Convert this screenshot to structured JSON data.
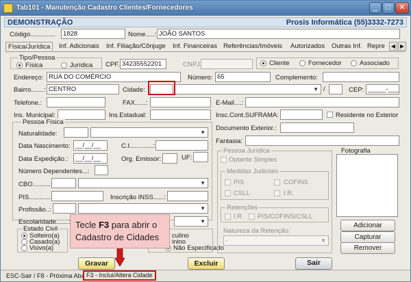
{
  "window": {
    "title": "Tab101 - Manutenção Cadastro Clientes/Fornecedores",
    "min": "_",
    "max": "□",
    "close": "✕"
  },
  "header": {
    "left": "DEMONSTRAÇÃO",
    "right": "Prosis Informática (55)3332-7273"
  },
  "codigo": {
    "label": "Código..............",
    "value": "1828"
  },
  "nome": {
    "label": "Nome.....:",
    "value": "JOÃO SANTOS"
  },
  "tabs": [
    "Física/Jurídica",
    "Inf. Adicionais",
    "Inf. Filiação/Cônjuge",
    "Inf. Financeiras",
    "Referências/Imóveis",
    "Autorizados",
    "Outras Inf.",
    "Repre"
  ],
  "tab_prev": "◀",
  "tab_next": "▶",
  "tipo_pessoa": {
    "title": "Tipo/Pessoa",
    "fisica": "Física",
    "juridica": "Jurídica"
  },
  "cpf": {
    "label": "CPF.:",
    "value": "34235552201"
  },
  "cnpj": {
    "label": "CNPJ.:"
  },
  "tipo_cliente": {
    "cliente": "Cliente",
    "fornecedor": "Fornecedor",
    "associado": "Associado"
  },
  "endereco": {
    "label": "Endereço:",
    "value": "RUA DO COMÉRCIO"
  },
  "numero": {
    "label": "Número:",
    "value": "65"
  },
  "complemento": {
    "label": "Complemento:"
  },
  "bairro": {
    "label": "Bairro.......:",
    "value": "CENTRO"
  },
  "cidade": {
    "label": "Cidade:",
    "slash": "/"
  },
  "cep": {
    "label": "CEP:",
    "mask": "_____-___"
  },
  "telefone": {
    "label": "Telefone.:"
  },
  "fax": {
    "label": "FAX......:"
  },
  "email": {
    "label": "E-Mail....:"
  },
  "ins_municipal": {
    "label": "Ins. Municipal:"
  },
  "ins_estadual": {
    "label": "Ins.Estadual:"
  },
  "suframa": {
    "label": "Insc.Cont.SUFRAMA:"
  },
  "residente": {
    "label": "Residente no Exterior"
  },
  "pessoa_fisica": {
    "title": "Pessoa Física",
    "naturalidade": "Naturalidade:",
    "nascimento": "Data Nascimento:",
    "date_mask": "__/__/__",
    "ci": "C.I.............:",
    "expedicao": "Data Expedição.:",
    "orgao": "Org. Emissor:",
    "uf": "UF:",
    "dependentes": "Número Dependentes...:",
    "cbo": "CBO..........:",
    "pis": "PIS............:",
    "inss": "Inscrição INSS......:",
    "profissao": "Profissão..:",
    "escolaridade": "Escolaridade.......:"
  },
  "documento_exterior": {
    "label": "Documento Exterior.:"
  },
  "fantasia": {
    "label": "Fantasia:"
  },
  "pessoa_juridica": {
    "title": "Pessoa Jurídica",
    "optante": "Optante Simples"
  },
  "medidas": {
    "title": "Medidas Judiciais",
    "pis": "PIS",
    "cofins": "COFINS",
    "csll": "CSLL",
    "ir": "I.R."
  },
  "retencoes": {
    "title": "Retenções",
    "ir": "I.R.",
    "piscofins": "PIS/COFINS/CSLL"
  },
  "natureza": {
    "label": "Natureza da Retenção:",
    "value": "-"
  },
  "fotografia": {
    "title": "Fotografia",
    "adicionar": "Adicionar",
    "capturar": "Capturar",
    "remover": "Remover"
  },
  "estado_civil": {
    "title": "Estado Civil",
    "solteiro": "Solteiro(a)",
    "casado": "Casado(a)",
    "viuvo": "Viúvo(a)"
  },
  "sexo": {
    "masculino": "culino",
    "feminino": "inino",
    "nao": "Não Especificado"
  },
  "callout": {
    "pre": "Tecle ",
    "key": "F3",
    "post": " para abrir o",
    "line2": "Cadastro de Cidades"
  },
  "buttons": {
    "gravar": "Gravar",
    "excluir": "Excluir",
    "sair": "Sair"
  },
  "status": {
    "left": "ESC-Sair / F8 - Próxima Aba",
    "hint": "F3 - Inclui/Altera Cidade"
  }
}
